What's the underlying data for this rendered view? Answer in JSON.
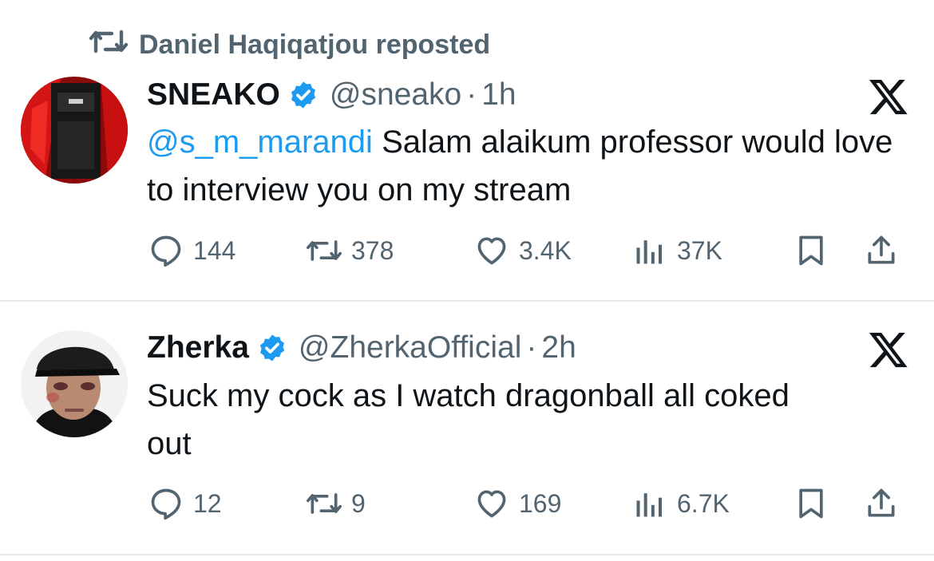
{
  "repost_banner": {
    "icon": "repost-icon",
    "text": "Daniel Haqiqatjou reposted"
  },
  "tweets": [
    {
      "display_name": "SNEAKO",
      "handle": "@sneako",
      "separator": "·",
      "time": "1h",
      "mention": "@s_m_marandi",
      "text": "Salam alaikum professor would love to interview you on my stream",
      "stats": {
        "replies": "144",
        "reposts": "378",
        "likes": "3.4K",
        "views": "37K"
      }
    },
    {
      "display_name": "Zherka",
      "handle": "@ZherkaOfficial",
      "separator": "·",
      "time": "2h",
      "text_line1": "Suck my cock as I watch dragonball all coked",
      "text_line2": "out",
      "stats": {
        "replies": "12",
        "reposts": "9",
        "likes": "169",
        "views": "6.7K"
      }
    }
  ],
  "colors": {
    "accent": "#1d9bf0",
    "muted": "#536471",
    "text": "#0f1419",
    "divider": "#e6e9ec"
  }
}
